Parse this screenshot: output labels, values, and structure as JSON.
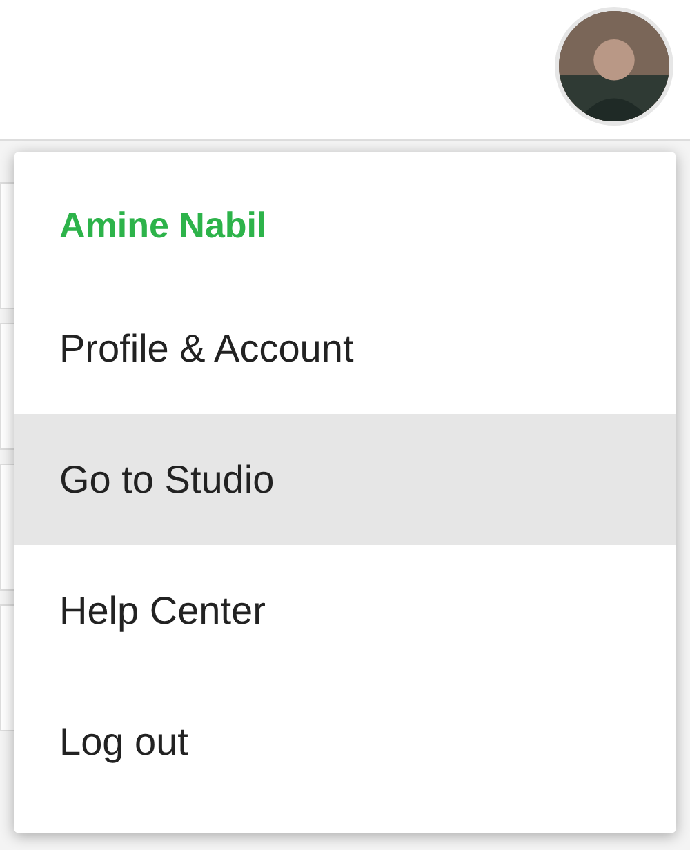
{
  "user_menu": {
    "user_name": "Amine Nabil",
    "items": [
      {
        "label": "Profile & Account",
        "selected": false
      },
      {
        "label": "Go to Studio",
        "selected": true
      },
      {
        "label": "Help Center",
        "selected": false
      },
      {
        "label": "Log out",
        "selected": false
      }
    ]
  }
}
